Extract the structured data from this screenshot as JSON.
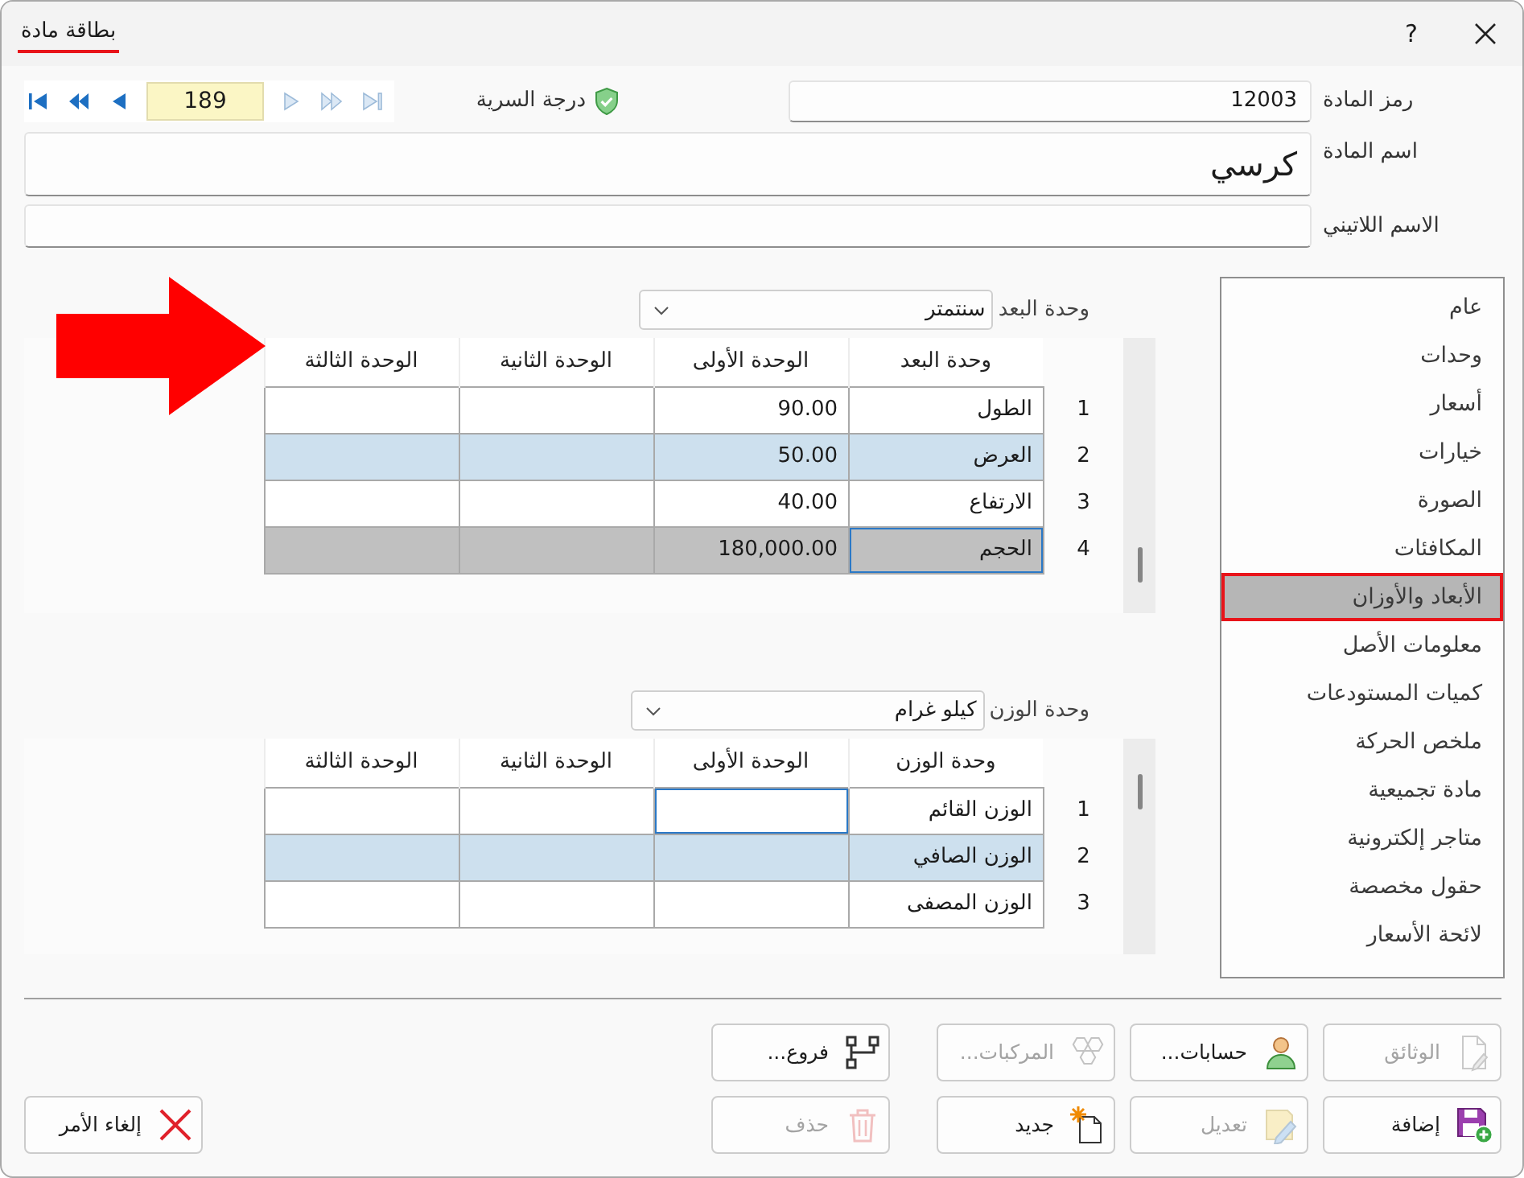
{
  "window": {
    "title": "بطاقة مادة",
    "help": "?"
  },
  "record_nav": {
    "items": [
      {
        "kind": "first",
        "disabled": false
      },
      {
        "kind": "fast_back",
        "disabled": false
      },
      {
        "kind": "back",
        "disabled": false
      },
      {
        "kind": "record",
        "value": "189"
      },
      {
        "kind": "forward",
        "disabled": true
      },
      {
        "kind": "fast_forward",
        "disabled": true
      },
      {
        "kind": "last",
        "disabled": true
      }
    ]
  },
  "security": {
    "label": "درجة السرية"
  },
  "fields": [
    {
      "label": "رمز المادة",
      "value": "12003",
      "kind": "short"
    },
    {
      "label": "اسم المادة",
      "value": "كرسي",
      "kind": "large"
    },
    {
      "label": "الاسم اللاتيني",
      "kind": "wide"
    }
  ],
  "sections": [
    {
      "label": "عام",
      "selected": false
    },
    {
      "label": "وحدات",
      "selected": false
    },
    {
      "label": "أسعار",
      "selected": false
    },
    {
      "label": "خيارات",
      "selected": false
    },
    {
      "label": "الصورة",
      "selected": false
    },
    {
      "label": "المكافئات",
      "selected": false
    },
    {
      "label": "الأبعاد والأوزان",
      "selected": true
    },
    {
      "label": "معلومات الأصل",
      "selected": false
    },
    {
      "label": "كميات المستودعات",
      "selected": false
    },
    {
      "label": "ملخص الحركة",
      "selected": false
    },
    {
      "label": "مادة تجميعية",
      "selected": false
    },
    {
      "label": "متاجر إلكترونية",
      "selected": false
    },
    {
      "label": "حقول مخصصة",
      "selected": false
    },
    {
      "label": "لائحة الأسعار",
      "selected": false
    }
  ],
  "dimension_grid": {
    "unit_label": "وحدة البعد",
    "unit_value": "سنتمتر",
    "columns": [
      "وحدة البعد",
      "الوحدة الأولى",
      "الوحدة الثانية",
      "الوحدة الثالثة"
    ],
    "rows": [
      {
        "number": "1",
        "kind": "plain",
        "cells": [
          {
            "text": "الطول",
            "focused": false
          },
          {
            "text": "90.00",
            "focused": false
          },
          {
            "focused": false
          },
          {
            "focused": false
          }
        ]
      },
      {
        "number": "2",
        "kind": "shaded",
        "cells": [
          {
            "text": "العرض",
            "focused": false
          },
          {
            "text": "50.00",
            "focused": false
          },
          {
            "focused": false
          },
          {
            "focused": false
          }
        ]
      },
      {
        "number": "3",
        "kind": "plain",
        "cells": [
          {
            "text": "الارتفاع",
            "focused": false
          },
          {
            "text": "40.00",
            "focused": false
          },
          {
            "focused": false
          },
          {
            "focused": false
          }
        ]
      },
      {
        "number": "4",
        "kind": "readonly",
        "cells": [
          {
            "text": "الحجم",
            "focused": true
          },
          {
            "text": "180,000.00",
            "focused": false
          },
          {
            "focused": false
          },
          {
            "focused": false
          }
        ]
      }
    ]
  },
  "weight_grid": {
    "unit_label": "وحدة الوزن",
    "unit_value": "كيلو غرام",
    "columns": [
      "وحدة الوزن",
      "الوحدة الأولى",
      "الوحدة الثانية",
      "الوحدة الثالثة"
    ],
    "rows": [
      {
        "number": "1",
        "kind": "plain",
        "cells": [
          {
            "text": "الوزن القائم",
            "focused": false
          },
          {
            "focused": true
          },
          {
            "focused": false
          },
          {
            "focused": false
          }
        ]
      },
      {
        "number": "2",
        "kind": "shaded",
        "cells": [
          {
            "text": "الوزن الصافي",
            "focused": false
          },
          {
            "focused": false
          },
          {
            "focused": false
          },
          {
            "focused": false
          }
        ]
      },
      {
        "number": "3",
        "kind": "plain",
        "cells": [
          {
            "text": "الوزن المصفى",
            "focused": false
          },
          {
            "focused": false
          },
          {
            "focused": false
          },
          {
            "focused": false
          }
        ]
      }
    ]
  },
  "buttons": [
    [
      {
        "label": "الوثائق",
        "disabled": true
      },
      {
        "label": "حسابات...",
        "disabled": false
      },
      {
        "label": "المركبات...",
        "disabled": true
      },
      {
        "label": "فروع...",
        "disabled": false
      }
    ],
    [
      {
        "label": "إضافة",
        "disabled": false
      },
      {
        "label": "تعديل",
        "disabled": true
      },
      {
        "label": "جديد",
        "disabled": false
      },
      {
        "label": "حذف",
        "disabled": true
      }
    ]
  ],
  "cancel_button": {
    "label": "إلغاء الأمر",
    "disabled": false
  }
}
